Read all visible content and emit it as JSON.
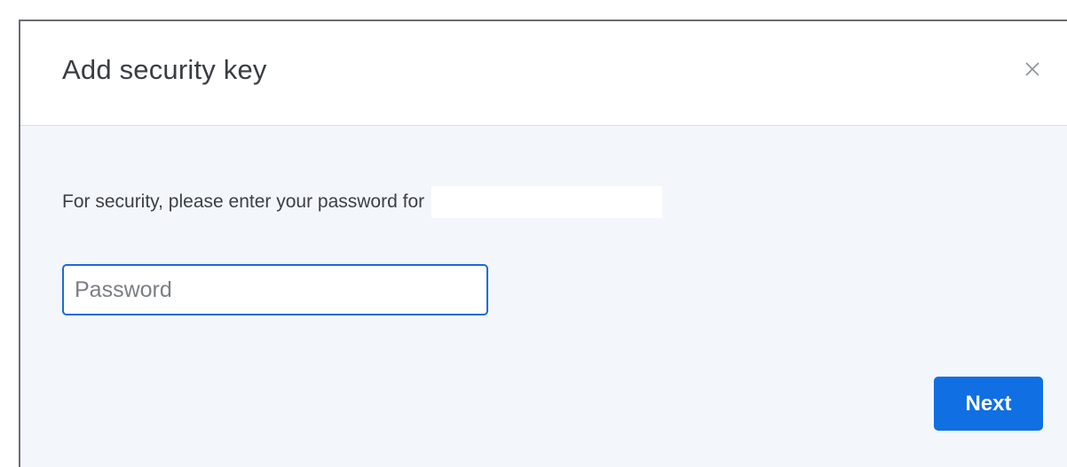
{
  "dialog": {
    "title": "Add security key",
    "close_icon": "close-icon",
    "prompt": "For security, please enter your password for",
    "password_placeholder": "Password",
    "next_label": "Next"
  },
  "colors": {
    "accent": "#0f6fe3",
    "input_border": "#1c6bd6",
    "body_background": "#f3f7fb"
  }
}
